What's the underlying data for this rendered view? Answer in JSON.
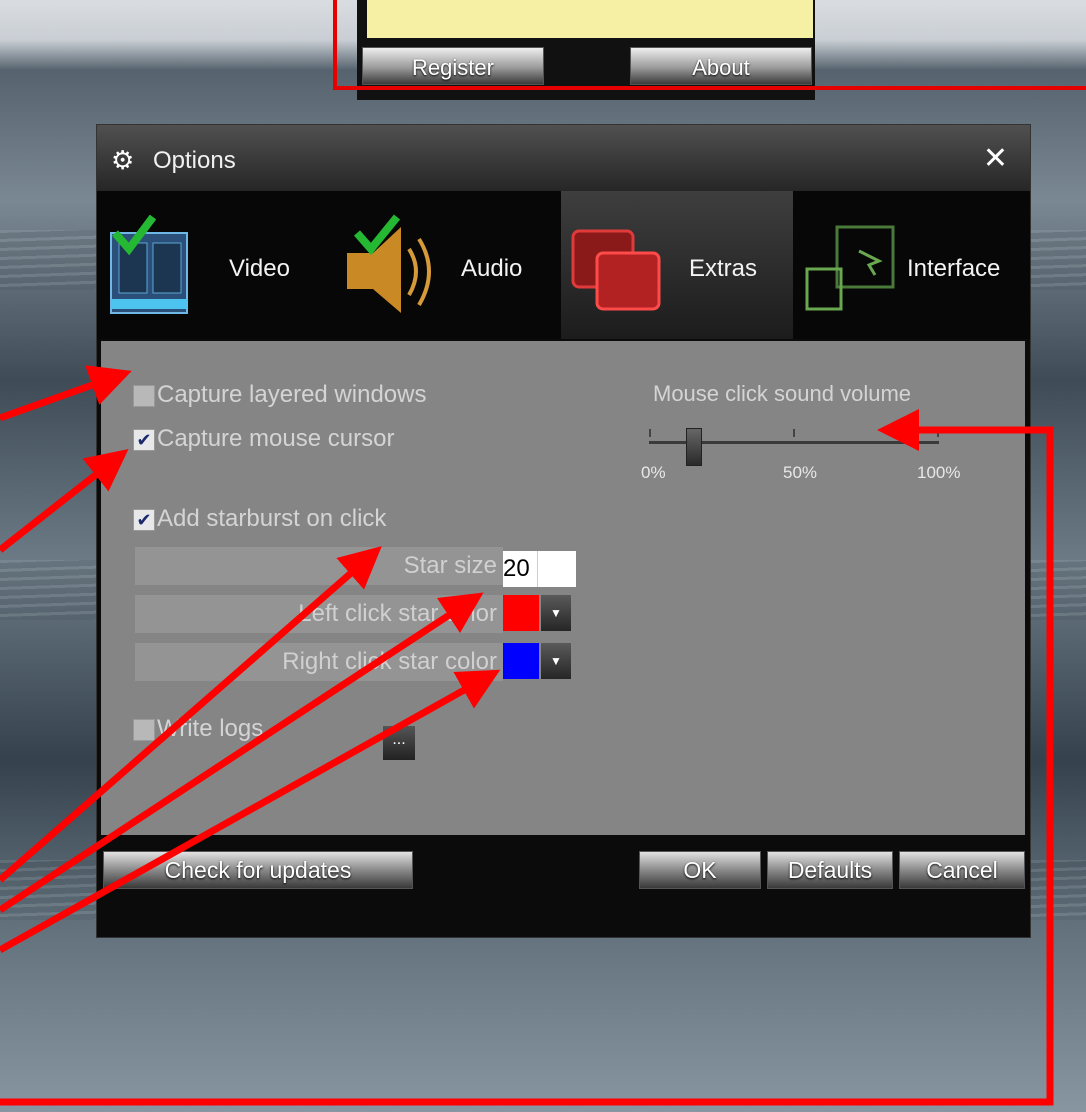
{
  "top_panel": {
    "register_label": "Register",
    "about_label": "About"
  },
  "dialog": {
    "title": "Options",
    "close_glyph": "✕",
    "tabs": [
      {
        "label": "Video",
        "icon": "film-icon",
        "checked": true
      },
      {
        "label": "Audio",
        "icon": "speaker-icon",
        "checked": true
      },
      {
        "label": "Extras",
        "icon": "windows-icon",
        "active": true
      },
      {
        "label": "Interface",
        "icon": "interface-icon"
      }
    ],
    "extras": {
      "capture_layered": {
        "label": "Capture layered windows",
        "checked": false
      },
      "capture_cursor": {
        "label": "Capture mouse cursor",
        "checked": true
      },
      "starburst": {
        "label": "Add starburst on click",
        "checked": true
      },
      "star_size": {
        "label": "Star size",
        "value": "20"
      },
      "left_color": {
        "label": "Left click star color",
        "color": "#ff0000"
      },
      "right_color": {
        "label": "Right click star color",
        "color": "#0000ff"
      },
      "write_logs": {
        "label": "Write logs",
        "checked": false,
        "browse_label": "..."
      },
      "volume": {
        "label": "Mouse click sound volume",
        "value_percent": 15,
        "min_label": "0%",
        "mid_label": "50%",
        "max_label": "100%"
      }
    },
    "buttons": {
      "updates": "Check for updates",
      "ok": "OK",
      "defaults": "Defaults",
      "cancel": "Cancel"
    }
  },
  "annotation_color": "#ff0000"
}
